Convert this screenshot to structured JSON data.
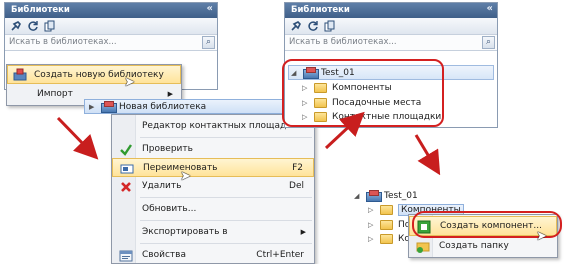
{
  "panel_title": "Библиотеки",
  "search_placeholder": "Искать в библиотеках...",
  "panel1_menu": {
    "create": "Создать новую библиотеку",
    "import": "Импорт"
  },
  "submenu_header": "Новая библиотека",
  "context_menu": {
    "editor": "Редактор контактных площадок...",
    "check": "Проверить",
    "rename": "Переименовать",
    "rename_shortcut": "F2",
    "delete": "Удалить",
    "delete_shortcut": "Del",
    "refresh": "Обновить...",
    "export": "Экспортировать в",
    "properties": "Свойства",
    "properties_shortcut": "Ctrl+Enter"
  },
  "tree": {
    "root": "Test_01",
    "children": [
      "Компоненты",
      "Посадочные места",
      "Контактные площадки"
    ]
  },
  "bottom_tree": {
    "root": "Test_01",
    "children": [
      "Компоненты",
      "По",
      "Ко"
    ]
  },
  "bottom_menu": {
    "create_component": "Создать компонент...",
    "create_folder": "Создать папку"
  },
  "colors": {
    "accent": "#3f5f88",
    "highlight": "#ffe39a",
    "arrow": "#c81e1e"
  }
}
